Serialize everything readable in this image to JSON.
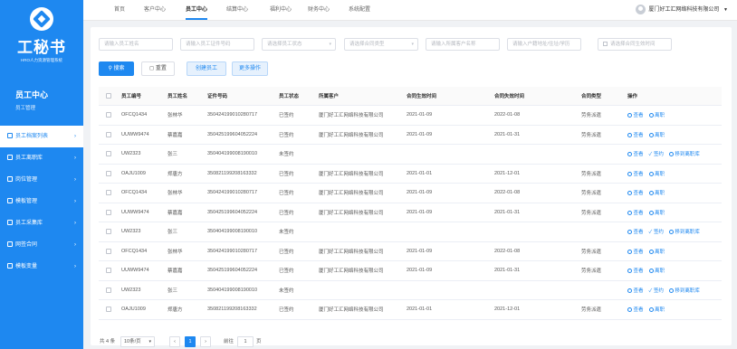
{
  "brand": {
    "name": "工秘书",
    "subtitle": "HRO人力资源管理系统"
  },
  "sidebar": {
    "title": "员工中心",
    "subtitle": "员工管理",
    "items": [
      {
        "label": "员工档案列表",
        "active": true
      },
      {
        "label": "员工离职库",
        "active": false
      },
      {
        "label": "岗位管理",
        "active": false
      },
      {
        "label": "模板管理",
        "active": false
      },
      {
        "label": "员工采集库",
        "active": false
      },
      {
        "label": "网签合同",
        "active": false
      },
      {
        "label": "模板变量",
        "active": false
      }
    ]
  },
  "topnav": {
    "tabs": [
      "首页",
      "客户中心",
      "员工中心",
      "结算中心",
      "福利中心",
      "财务中心",
      "系统配置"
    ],
    "active_index": 2,
    "company": "厦门好工汇网络科技有限公司"
  },
  "filters": {
    "employee_name": "请输入员工姓名",
    "id_number": "请输入员工证件号码",
    "status": "请选择员工状态",
    "contract_type": "请选择合同类型",
    "customer": "请输入所属客户名称",
    "account": "请输入户籍地址/住址/学历",
    "date": "请选择合同生效时间"
  },
  "actions": {
    "search": "搜索",
    "reset": "重置",
    "create": "创建员工",
    "more": "更多操作"
  },
  "table": {
    "columns": [
      "员工编号",
      "员工姓名",
      "证件号码",
      "员工状态",
      "所属客户",
      "合同生效时间",
      "合同失效时间",
      "合同类型",
      "操作"
    ],
    "rows": [
      {
        "id": "OFCQ1434",
        "name": "张林华",
        "cert": "350424199010280717",
        "status": "已签约",
        "customer": "厦门好工汇网络科技有限公司",
        "start": "2021-01-09",
        "end": "2022-01-08",
        "type": "劳务派遣",
        "ops": [
          "查看",
          "离职"
        ]
      },
      {
        "id": "UUWW9474",
        "name": "蔡嘉嘉",
        "cert": "350425199604052224",
        "status": "已签约",
        "customer": "厦门好工汇网络科技有限公司",
        "start": "2021-01-09",
        "end": "2021-01-31",
        "type": "劳务派遣",
        "ops": [
          "查看",
          "离职"
        ]
      },
      {
        "id": "UW2323",
        "name": "张三",
        "cert": "350404199008190010",
        "status": "未签约",
        "customer": "",
        "start": "",
        "end": "",
        "type": "",
        "ops": [
          "查看",
          "签约",
          "移到离职库"
        ]
      },
      {
        "id": "OAJU1009",
        "name": "郑唐方",
        "cert": "350821199208163332",
        "status": "已签约",
        "customer": "厦门好工汇网络科技有限公司",
        "start": "2021-01-01",
        "end": "2021-12-01",
        "type": "劳务派遣",
        "ops": [
          "查看",
          "离职"
        ]
      },
      {
        "id": "OFCQ1434",
        "name": "张林华",
        "cert": "350424199010280717",
        "status": "已签约",
        "customer": "厦门好工汇网络科技有限公司",
        "start": "2021-01-09",
        "end": "2022-01-08",
        "type": "劳务派遣",
        "ops": [
          "查看",
          "离职"
        ]
      },
      {
        "id": "UUWW9474",
        "name": "蔡嘉嘉",
        "cert": "350425199604052224",
        "status": "已签约",
        "customer": "厦门好工汇网络科技有限公司",
        "start": "2021-01-09",
        "end": "2021-01-31",
        "type": "劳务派遣",
        "ops": [
          "查看",
          "离职"
        ]
      },
      {
        "id": "UW2323",
        "name": "张三",
        "cert": "350404199008190010",
        "status": "未签约",
        "customer": "",
        "start": "",
        "end": "",
        "type": "",
        "ops": [
          "查看",
          "签约",
          "移到离职库"
        ]
      },
      {
        "id": "OFCQ1434",
        "name": "张林华",
        "cert": "350424199010280717",
        "status": "已签约",
        "customer": "厦门好工汇网络科技有限公司",
        "start": "2021-01-09",
        "end": "2022-01-08",
        "type": "劳务派遣",
        "ops": [
          "查看",
          "离职"
        ]
      },
      {
        "id": "UUWW9474",
        "name": "蔡嘉嘉",
        "cert": "350425199604052224",
        "status": "已签约",
        "customer": "厦门好工汇网络科技有限公司",
        "start": "2021-01-09",
        "end": "2021-01-31",
        "type": "劳务派遣",
        "ops": [
          "查看",
          "离职"
        ]
      },
      {
        "id": "UW2323",
        "name": "张三",
        "cert": "350404199008190010",
        "status": "未签约",
        "customer": "",
        "start": "",
        "end": "",
        "type": "",
        "ops": [
          "查看",
          "签约",
          "移到离职库"
        ]
      },
      {
        "id": "OAJU1009",
        "name": "郑唐方",
        "cert": "350821199208163332",
        "status": "已签约",
        "customer": "厦门好工汇网络科技有限公司",
        "start": "2021-01-01",
        "end": "2021-12-01",
        "type": "劳务派遣",
        "ops": [
          "查看",
          "离职"
        ]
      }
    ]
  },
  "pagination": {
    "total": "共 4 条",
    "page_size": "10条/页",
    "current": "1",
    "goto_label": "前往",
    "goto_value": "1",
    "page_unit": "页"
  },
  "colors": {
    "primary": "#1e88f0",
    "sidebar_bg": "#1e88f0"
  }
}
